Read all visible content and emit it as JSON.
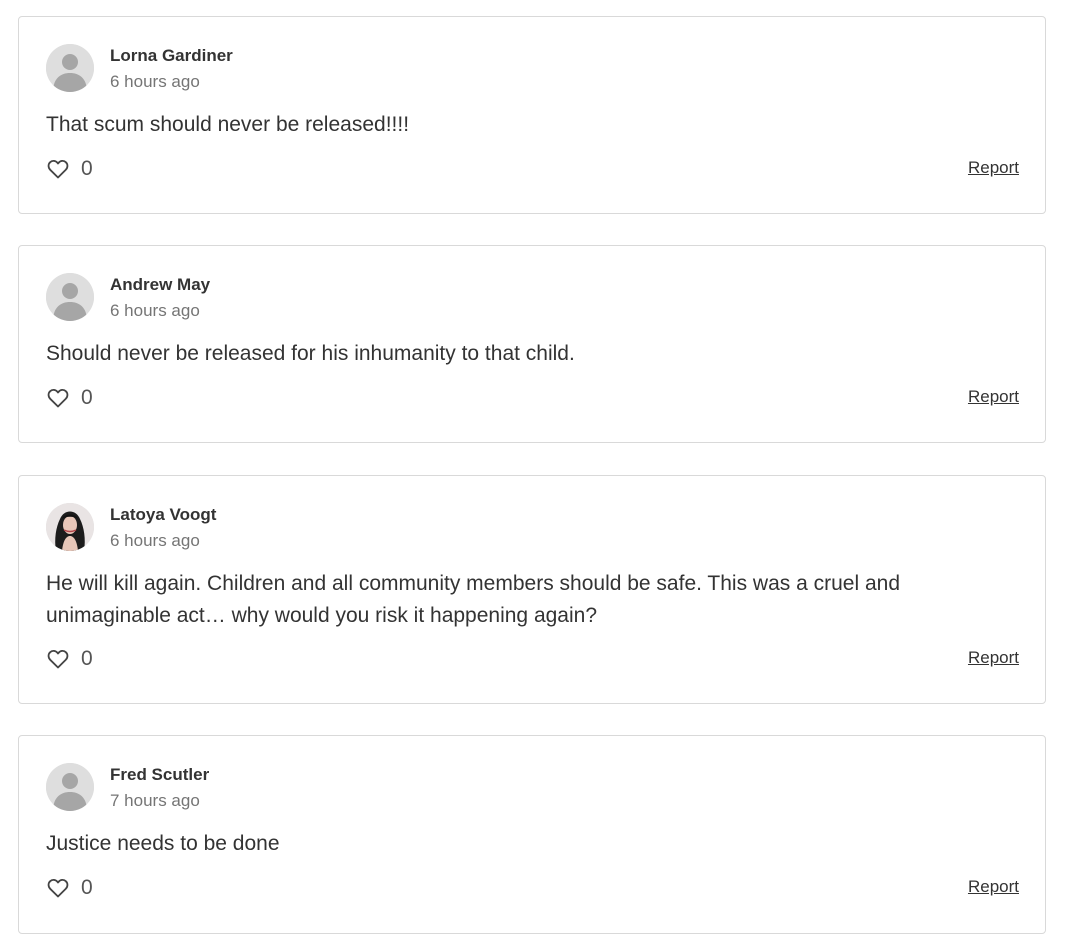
{
  "comments": [
    {
      "author": "Lorna Gardiner",
      "time": "6 hours ago",
      "text": "That scum should never be released!!!!",
      "likes": "0",
      "report_label": "Report",
      "avatar": "default-avatar-icon"
    },
    {
      "author": "Andrew May",
      "time": "6 hours ago",
      "text": "Should never be released for his inhumanity to that child.",
      "likes": "0",
      "report_label": "Report",
      "avatar": "default-avatar-icon"
    },
    {
      "author": "Latoya Voogt",
      "time": "6 hours ago",
      "text": "He will kill again. Children and all community members should be safe. This was a cruel and unimaginable act… why would you risk it happening again?",
      "likes": "0",
      "report_label": "Report",
      "avatar": "user-photo"
    },
    {
      "author": "Fred Scutler",
      "time": "7 hours ago",
      "text": "Justice needs to be done",
      "likes": "0",
      "report_label": "Report",
      "avatar": "default-avatar-icon"
    }
  ],
  "colors": {
    "border": "#d9d9d9",
    "avatar_bg": "#dedede",
    "avatar_fg": "#a6a6a6",
    "text": "#333333",
    "muted": "#757575"
  }
}
